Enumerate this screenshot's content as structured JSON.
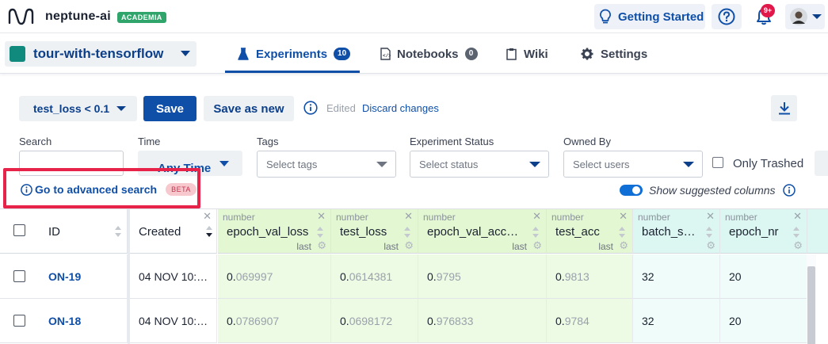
{
  "header": {
    "app_name": "neptune-ai",
    "badge": "ACADEMIA",
    "getting_started": "Getting Started",
    "notifications": "9+"
  },
  "project": {
    "name": "tour-with-tensorflow",
    "color": "#0f8a7d"
  },
  "tabs": [
    {
      "label": "Experiments",
      "count": "10",
      "active": true
    },
    {
      "label": "Notebooks",
      "count": "0"
    },
    {
      "label": "Wiki"
    },
    {
      "label": "Settings"
    }
  ],
  "toolbar": {
    "view": "test_loss < 0.1",
    "save": "Save",
    "save_as_new": "Save as new",
    "edited": "Edited",
    "discard": "Discard changes"
  },
  "filters": {
    "search_label": "Search",
    "search_value": "",
    "time_label": "Time",
    "time_value": "Any Time",
    "tags_label": "Tags",
    "tags_placeholder": "Select tags",
    "status_label": "Experiment Status",
    "status_placeholder": "Select status",
    "owner_label": "Owned By",
    "owner_placeholder": "Select users",
    "only_trashed": "Only Trashed",
    "advanced_search": "Go to advanced search",
    "beta": "BETA",
    "show_suggested": "Show suggested columns"
  },
  "table": {
    "columns": [
      {
        "name": "ID"
      },
      {
        "name": "Created"
      },
      {
        "type": "number",
        "name": "epoch_val_loss",
        "agg": "last"
      },
      {
        "type": "number",
        "name": "test_loss",
        "agg": "last"
      },
      {
        "type": "number",
        "name": "epoch_val_acc…",
        "agg": "last"
      },
      {
        "type": "number",
        "name": "test_acc",
        "agg": "last"
      },
      {
        "type": "number",
        "name": "batch_s…"
      },
      {
        "type": "number",
        "name": "epoch_nr"
      }
    ],
    "rows": [
      {
        "id": "ON-19",
        "created": "04 NOV 10:…",
        "epoch_val_loss": [
          "0.",
          "069997"
        ],
        "test_loss": [
          "0.",
          "0614381"
        ],
        "epoch_val_acc": [
          "0.",
          "9795"
        ],
        "test_acc": [
          "0.",
          "9813"
        ],
        "batch_size": "32",
        "epoch_nr": "20"
      },
      {
        "id": "ON-18",
        "created": "04 NOV 10:…",
        "epoch_val_loss": [
          "0.",
          "0786907"
        ],
        "test_loss": [
          "0.",
          "0698172"
        ],
        "epoch_val_acc": [
          "0.",
          "976833"
        ],
        "test_acc": [
          "0.",
          "9784"
        ],
        "batch_size": "32",
        "epoch_nr": "20"
      }
    ]
  }
}
